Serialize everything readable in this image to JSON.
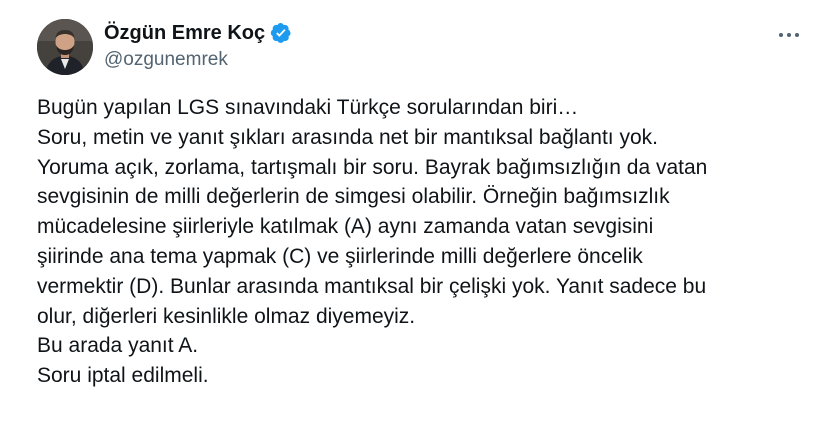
{
  "author": {
    "name": "Özgün Emre Koç",
    "handle": "@ozgunemrek",
    "verified": true,
    "verified_color": "#1d9bf0"
  },
  "icons": {
    "more": "more-horizontal-icon",
    "verified": "verified-badge-icon"
  },
  "tweet": {
    "lines": [
      "Bugün yapılan LGS sınavındaki Türkçe sorularından biri…",
      "Soru, metin ve yanıt şıkları arasında net bir mantıksal bağlantı yok.",
      "Yoruma açık, zorlama, tartışmalı bir soru. Bayrak bağımsızlığın da vatan",
      "sevgisinin de milli değerlerin de simgesi olabilir. Örneğin bağımsızlık",
      "mücadelesine şiirleriyle katılmak (A) aynı zamanda vatan sevgisini",
      "şiirinde ana tema yapmak (C) ve şiirlerinde milli değerlere öncelik",
      "vermektir (D). Bunlar arasında mantıksal bir çelişki yok. Yanıt sadece bu",
      "olur, diğerleri kesinlikle olmaz diyemeyiz.",
      "Bu arada yanıt A.",
      "Soru iptal edilmeli."
    ]
  }
}
